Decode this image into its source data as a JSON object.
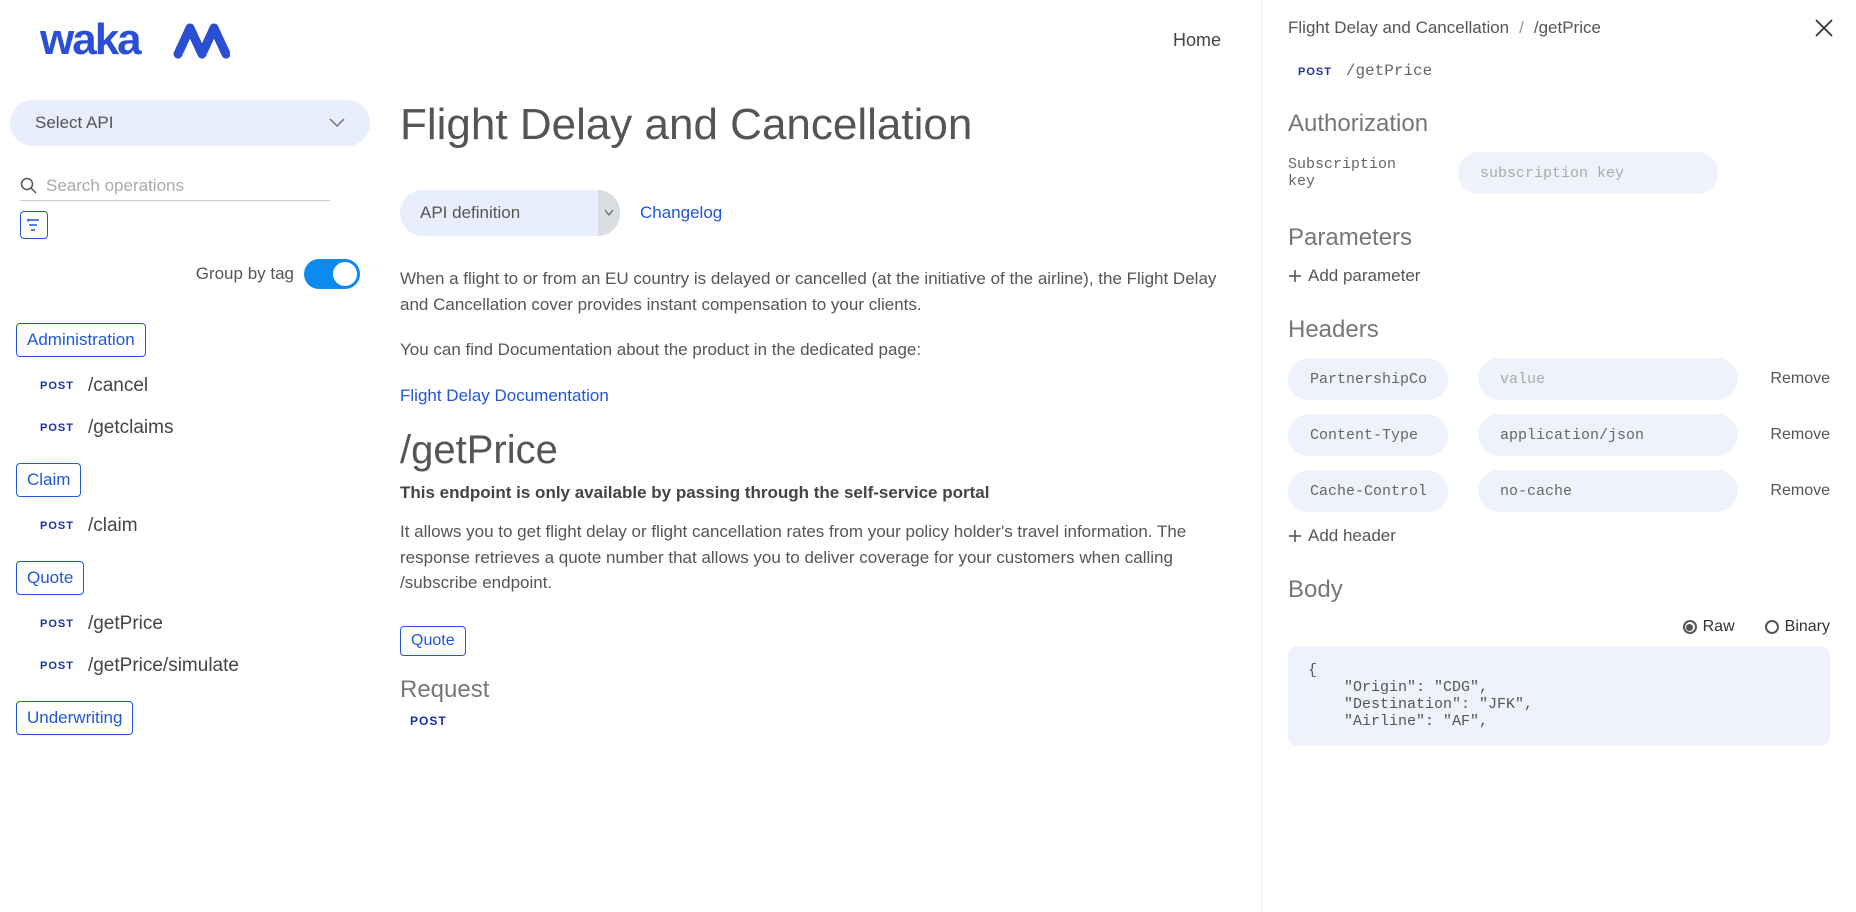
{
  "logo_alt": "wakam",
  "nav": {
    "home": "Home"
  },
  "sidebar": {
    "select_api": "Select API",
    "search_placeholder": "Search operations",
    "group_by_tag": "Group by tag",
    "tags": [
      {
        "name": "Administration",
        "ops": [
          {
            "method": "POST",
            "path": "/cancel"
          },
          {
            "method": "POST",
            "path": "/getclaims"
          }
        ]
      },
      {
        "name": "Claim",
        "ops": [
          {
            "method": "POST",
            "path": "/claim"
          }
        ]
      },
      {
        "name": "Quote",
        "ops": [
          {
            "method": "POST",
            "path": "/getPrice"
          },
          {
            "method": "POST",
            "path": "/getPrice/simulate"
          }
        ]
      },
      {
        "name": "Underwriting",
        "ops": []
      }
    ]
  },
  "doc": {
    "title": "Flight Delay and Cancellation",
    "api_definition": "API definition",
    "changelog": "Changelog",
    "para1": "When a flight to or from an EU country is delayed or cancelled (at the initiative of the airline), the Flight Delay and Cancellation cover provides instant compensation to your clients.",
    "para2": "You can find Documentation about the product in the dedicated page:",
    "doc_link": "Flight Delay Documentation",
    "endpoint_title": "/getPrice",
    "endpoint_sub": "This endpoint is only available by passing through the self-service portal",
    "endpoint_desc": "It allows you to get flight delay or flight cancellation rates from your policy holder's travel information. The response retrieves a quote number that allows you to deliver coverage for your customers when calling /subscribe endpoint.",
    "quote_tag": "Quote",
    "request_h": "Request",
    "request_method": "POST"
  },
  "panel": {
    "crumb1": "Flight Delay and Cancellation",
    "crumb2": "/getPrice",
    "method": "POST",
    "path": "/getPrice",
    "auth_h": "Authorization",
    "auth_label": "Subscription key",
    "auth_placeholder": "subscription key",
    "params_h": "Parameters",
    "add_parameter": "Add parameter",
    "headers_h": "Headers",
    "headers": [
      {
        "name": "PartnershipCode",
        "value": "",
        "value_placeholder": "value"
      },
      {
        "name": "Content-Type",
        "value": "application/json",
        "value_placeholder": "value"
      },
      {
        "name": "Cache-Control",
        "value": "no-cache",
        "value_placeholder": "value"
      }
    ],
    "remove": "Remove",
    "add_header": "Add header",
    "body_h": "Body",
    "raw": "Raw",
    "binary": "Binary",
    "body_code": "{\n    \"Origin\": \"CDG\",\n    \"Destination\": \"JFK\",\n    \"Airline\": \"AF\","
  }
}
